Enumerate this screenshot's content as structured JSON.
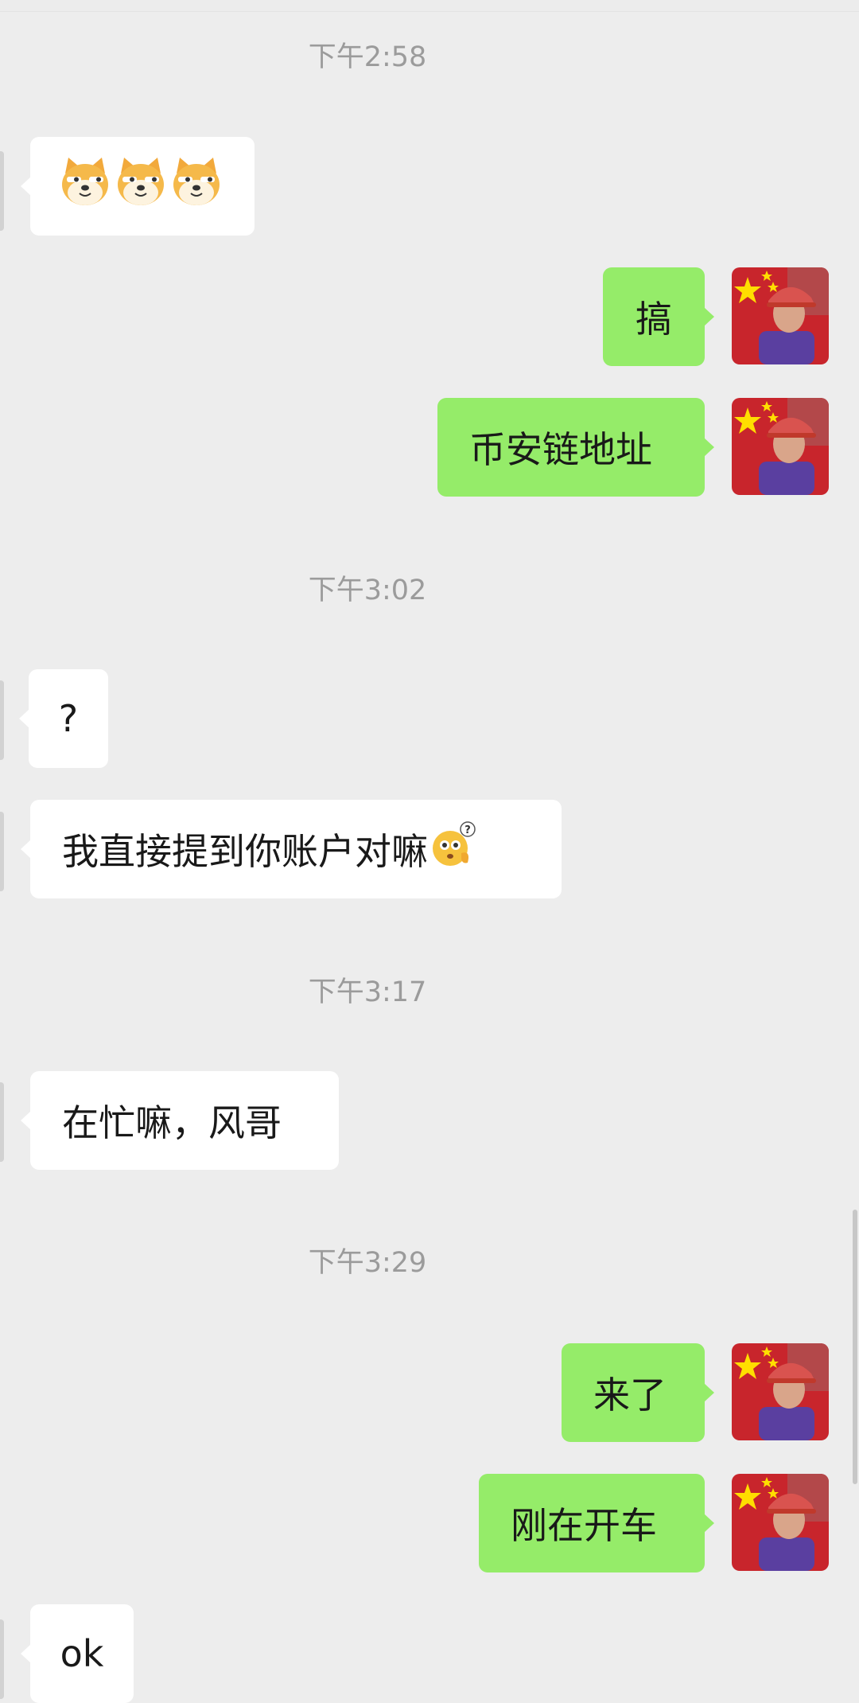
{
  "timestamps": [
    "下午2:58",
    "下午3:02",
    "下午3:17",
    "下午3:29"
  ],
  "messages": [
    {
      "side": "in",
      "text": "",
      "emoji": [
        "doge-face",
        "doge-face",
        "doge-face"
      ]
    },
    {
      "side": "out",
      "text": "搞"
    },
    {
      "side": "out",
      "text": "币安链地址"
    },
    {
      "side": "in",
      "text": "?"
    },
    {
      "side": "in",
      "text": "我直接提到你账户对嘛",
      "emoji": [
        "confused-question-face"
      ]
    },
    {
      "side": "in",
      "text": "在忙嘛，风哥"
    },
    {
      "side": "out",
      "text": "来了"
    },
    {
      "side": "out",
      "text": "刚在开车"
    },
    {
      "side": "in",
      "text": "ok"
    }
  ],
  "colors": {
    "background": "#ededed",
    "incoming_bubble": "#ffffff",
    "outgoing_bubble": "#95ec69",
    "timestamp_text": "#9b9b9b",
    "message_text": "#191919"
  },
  "icons": {
    "contact_avatar": "avatar-red-cap-flag",
    "sticker": "doge-emoji",
    "question_emoji": "thinking-question-emoji"
  }
}
